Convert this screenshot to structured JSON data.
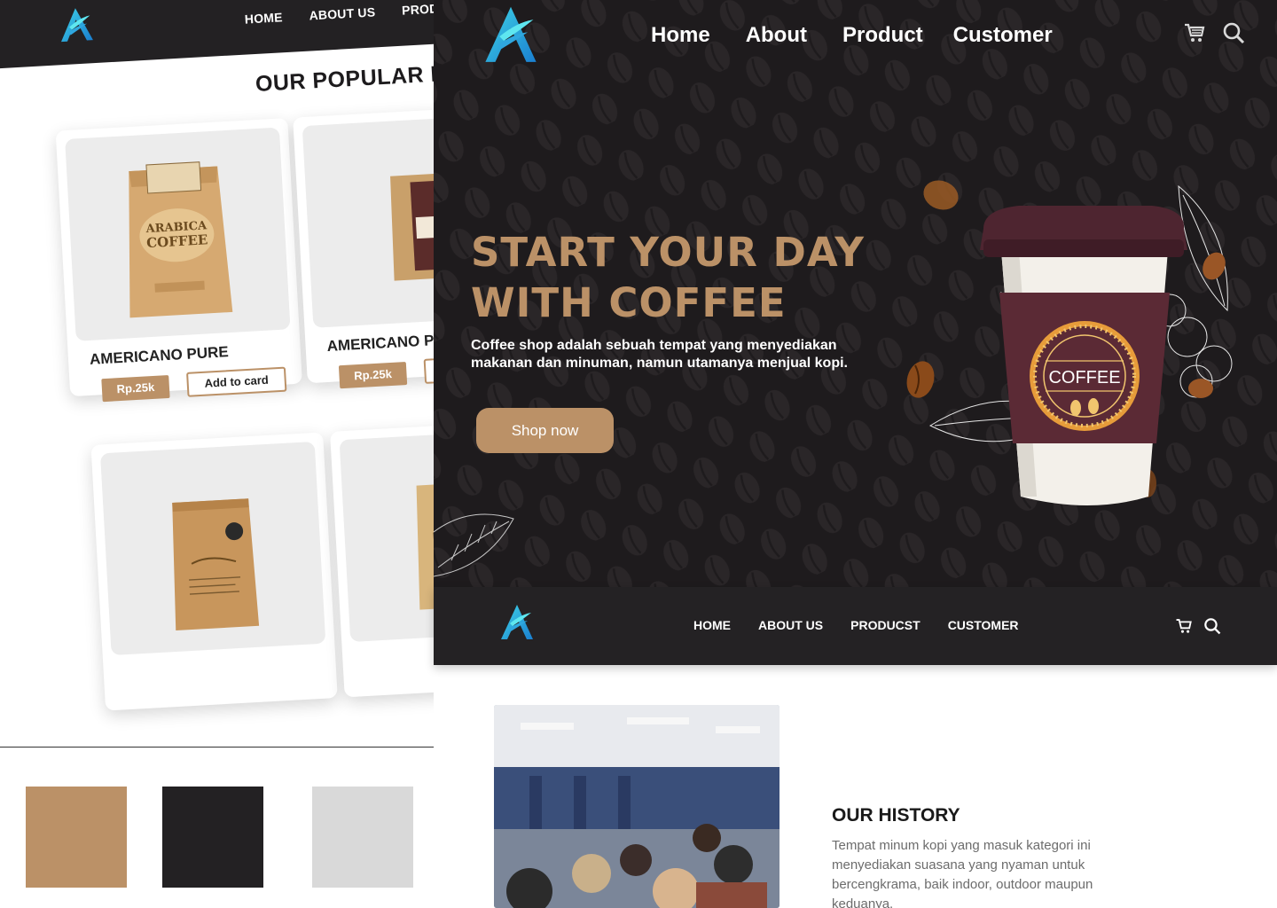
{
  "left_mockup": {
    "nav": {
      "items": [
        "HOME",
        "ABOUT US",
        "PROD"
      ]
    },
    "section_title": "OUR POPULAR P",
    "cards": [
      {
        "name": "AMERICANO PURE",
        "price": "Rp.25k",
        "add_label": "Add to card",
        "package_text": "ARABICA COFFEE"
      },
      {
        "name": "AMERICANO P",
        "price": "Rp.25k",
        "add_label": "A"
      },
      {
        "name": "",
        "price": "",
        "add_label": ""
      },
      {
        "name": "",
        "price": "",
        "add_label": ""
      }
    ],
    "palette": [
      "#bb9167",
      "#232123",
      "#d9d9d9"
    ]
  },
  "hero": {
    "nav": {
      "items": [
        "Home",
        "About",
        "Product",
        "Customer"
      ]
    },
    "icons": [
      "cart-icon",
      "search-icon"
    ],
    "title_line1": "START YOUR DAY",
    "title_line2": "WITH COFFEE",
    "description": "Coffee shop adalah sebuah tempat yang menyediakan makanan dan minuman, namun utamanya menjual kopi.",
    "cta_label": "Shop now",
    "cup_label": "COFFEE",
    "accent": "#bb9167",
    "background": "#1e1b1d"
  },
  "secondary_nav": {
    "items": [
      "HOME",
      "ABOUT US",
      "PRODUCST",
      "CUSTOMER"
    ],
    "icons": [
      "cart-icon",
      "search-icon"
    ]
  },
  "history": {
    "title": "OUR HISTORY",
    "text": "Tempat minum kopi yang masuk kategori ini menyediakan suasana yang nyaman untuk bercengkrama, baik indoor, outdoor maupun keduanya."
  }
}
